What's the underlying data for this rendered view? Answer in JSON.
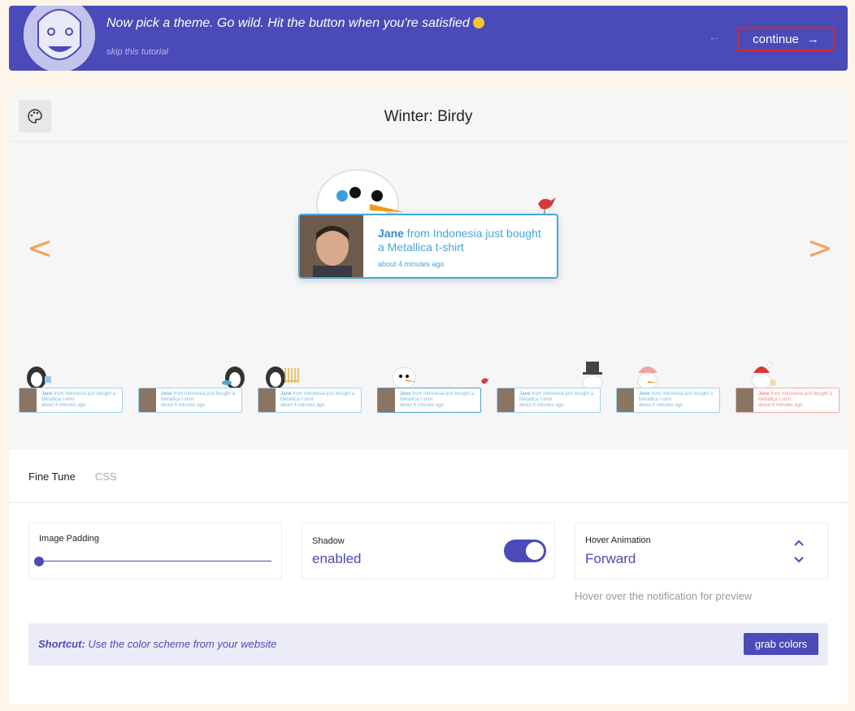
{
  "banner": {
    "message": "Now pick a theme. Go wild. Hit the button when you're satisfied",
    "skip_label": "skip this tutorial",
    "back_icon": "arrow-left-icon",
    "continue_label": "continue",
    "continue_icon": "arrow-right-icon",
    "background_color": "#4a4bb8",
    "highlight_color": "#e0262b"
  },
  "theme": {
    "title": "Winter: Birdy",
    "palette_icon": "palette-icon",
    "prev_label": "<",
    "next_label": ">"
  },
  "notification": {
    "name": "Jane",
    "message": " from Indonesia just bought a Metallica t-shirt",
    "time": "about 4 minutes ago",
    "accent_color": "#48a6d9"
  },
  "thumbnails": [
    {
      "name": "Jane",
      "message": " from Indonesia just bought a Metallica t-shirt",
      "time": "about 4 minutes ago"
    },
    {
      "name": "Jane",
      "message": " from Indonesia just bought a Metallica t-shirt",
      "time": "about 4 minutes ago"
    },
    {
      "name": "Jane",
      "message": " from Indonesia just bought a Metallica t-shirt",
      "time": "about 4 minutes ago"
    },
    {
      "name": "Jane",
      "message": " from Indonesia just bought a Metallica t-shirt",
      "time": "about 4 minutes ago"
    },
    {
      "name": "Jane",
      "message": " from Indonesia just bought a Metallica t-shirt",
      "time": "about 4 minutes ago"
    },
    {
      "name": "Jane",
      "message": " from Indonesia just bought a Metallica t-shirt",
      "time": "about 4 minutes ago"
    },
    {
      "name": "Jane",
      "message": " from Indonesia just bought a Metallica t-shirt",
      "time": "about 4 minutes ago"
    }
  ],
  "tabs": {
    "fine_tune": "Fine Tune",
    "css": "CSS",
    "active": "Fine Tune"
  },
  "settings": {
    "image_padding": {
      "label": "Image Padding",
      "value": 0
    },
    "shadow": {
      "label": "Shadow",
      "value": "enabled"
    },
    "hover_animation": {
      "label": "Hover Animation",
      "value": "Forward",
      "hint": "Hover over the notification for preview"
    }
  },
  "shortcut": {
    "prefix": "Shortcut:",
    "text": " Use the color scheme from your website",
    "button_label": "grab colors"
  }
}
